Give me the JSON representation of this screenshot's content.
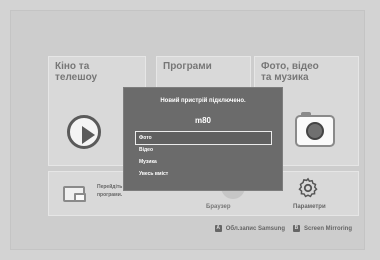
{
  "tiles": {
    "movies": {
      "title": "Кіно та\nтелешоу"
    },
    "apps": {
      "title": "Програми"
    },
    "photo": {
      "title": "Фото, відео\nта музика"
    }
  },
  "bottom": {
    "tip": "Перейдіть до ... підключіться, ... рекомендовані програми.",
    "browser_label": "Браузер",
    "settings_label": "Параметри"
  },
  "footer": {
    "key_a": "A",
    "key_a_label": "Обл.запис Samsung",
    "key_b": "B",
    "key_b_label": "Screen Mirroring"
  },
  "dialog": {
    "title": "Новий пристрій підключено.",
    "device": "m80",
    "options": [
      "Фото",
      "Відео",
      "Музика",
      "Увесь вміст"
    ],
    "selected_index": 0
  },
  "icons": {
    "play": "play-icon",
    "camera": "camera-icon",
    "gear": "gear-icon",
    "browser": "browser-icon",
    "screen-mirror": "screen-mirror-icon"
  }
}
